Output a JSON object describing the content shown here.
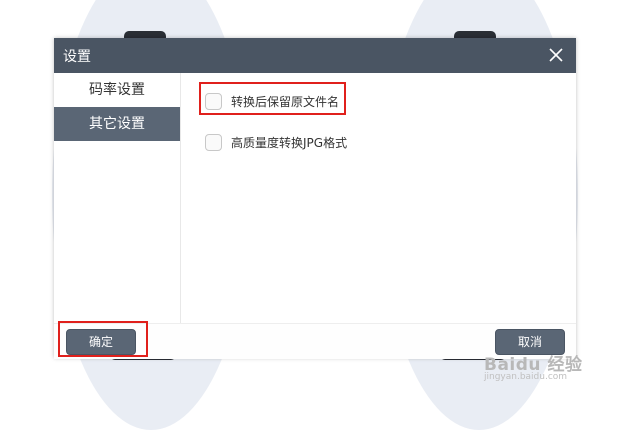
{
  "dialog": {
    "title": "设置",
    "close_icon": "close-icon"
  },
  "sidebar": {
    "items": [
      {
        "label": "码率设置",
        "active": false
      },
      {
        "label": "其它设置",
        "active": true
      }
    ]
  },
  "options": [
    {
      "label": "转换后保留原文件名",
      "checked": false,
      "highlighted": true
    },
    {
      "label": "高质量度转换JPG格式",
      "checked": false,
      "highlighted": false
    }
  ],
  "footer": {
    "confirm_label": "确定",
    "cancel_label": "取消"
  },
  "watermark": {
    "brand": "Baidu 经验",
    "url": "jingyan.baidu.com"
  },
  "colors": {
    "titlebar": "#4a5563",
    "active_tab": "#5a6675",
    "highlight": "#e0201c"
  }
}
